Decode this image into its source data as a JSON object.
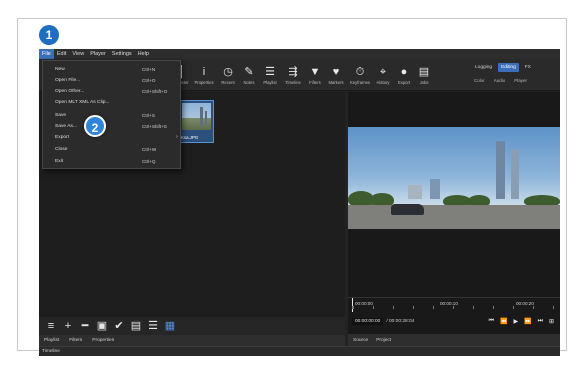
{
  "menubar": [
    "File",
    "Edit",
    "View",
    "Player",
    "Settings",
    "Help"
  ],
  "toolbar": [
    {
      "label": "Peak Meter",
      "icon": "peak-meter-icon",
      "glyph": "▐"
    },
    {
      "label": "Properties",
      "icon": "info-icon",
      "glyph": "i"
    },
    {
      "label": "Recent",
      "icon": "clock-icon",
      "glyph": "◷"
    },
    {
      "label": "Notes",
      "icon": "notes-icon",
      "glyph": "✎"
    },
    {
      "label": "Playlist",
      "icon": "list-icon",
      "glyph": "☰"
    },
    {
      "label": "Timeline",
      "icon": "timeline-icon",
      "glyph": "⇶"
    },
    {
      "label": "Filters",
      "icon": "filter-icon",
      "glyph": "▼"
    },
    {
      "label": "Markers",
      "icon": "marker-icon",
      "glyph": "♥"
    },
    {
      "label": "Keyframes",
      "icon": "stopwatch-icon",
      "glyph": "⏱"
    },
    {
      "label": "History",
      "icon": "history-icon",
      "glyph": "⌖"
    },
    {
      "label": "Export",
      "icon": "export-icon",
      "glyph": "●"
    },
    {
      "label": "Jobs",
      "icon": "jobs-icon",
      "glyph": "▤"
    }
  ],
  "layouts": {
    "tabs": [
      "Logging",
      "Editing",
      "FX"
    ],
    "selected": "Editing",
    "subs": [
      "Color",
      "Audio",
      "Player"
    ]
  },
  "file_menu": [
    {
      "label": "New",
      "shortcut": "Ctrl+N"
    },
    {
      "label": "Open File...",
      "shortcut": "Ctrl+O"
    },
    {
      "label": "Open Other...",
      "shortcut": "Ctrl+Shift+O"
    },
    {
      "label": "Open MLT XML As Clip...",
      "shortcut": ""
    },
    {
      "label": "Save",
      "shortcut": "Ctrl+S"
    },
    {
      "label": "Save As...",
      "shortcut": "Ctrl+Shift+S"
    },
    {
      "label": "Export",
      "shortcut": "",
      "submenu": "›"
    },
    {
      "label": "Close",
      "shortcut": "Ctrl+W"
    },
    {
      "label": "Exit",
      "shortcut": "Ctrl+Q"
    }
  ],
  "playlist": {
    "thumbnail_caption": "Ksa.JPG"
  },
  "left_tools": [
    {
      "icon": "menu-icon",
      "glyph": "≡"
    },
    {
      "icon": "add-icon",
      "glyph": "+"
    },
    {
      "icon": "remove-icon",
      "glyph": "━"
    },
    {
      "icon": "update-icon",
      "glyph": "▣"
    },
    {
      "icon": "check-icon",
      "glyph": "✔"
    },
    {
      "icon": "details-view-icon",
      "glyph": "▤"
    },
    {
      "icon": "list-view-icon",
      "glyph": "☰"
    },
    {
      "icon": "grid-view-icon",
      "glyph": "▦"
    }
  ],
  "left_tabs": [
    "Playlist",
    "Filters",
    "Properties"
  ],
  "status_bar": "Timeline",
  "ruler_ticks": [
    "00:00:00",
    "00:00:10",
    "00:00:20"
  ],
  "transport": {
    "timecode": "00:00:00:00",
    "duration": "/ 00:00:28:04",
    "buttons": [
      {
        "icon": "skip-start-icon",
        "glyph": "⏮"
      },
      {
        "icon": "rewind-icon",
        "glyph": "⏪"
      },
      {
        "icon": "play-icon",
        "glyph": "▶"
      },
      {
        "icon": "fast-forward-icon",
        "glyph": "⏩"
      },
      {
        "icon": "skip-end-icon",
        "glyph": "⏭"
      },
      {
        "icon": "grid-toggle-icon",
        "glyph": "⊞"
      }
    ]
  },
  "viewer_tabs": [
    "Source",
    "Project"
  ],
  "callouts": [
    "1",
    "2"
  ],
  "colors": {
    "accent": "#3b6fb8",
    "callout": "#1f6fc0"
  }
}
